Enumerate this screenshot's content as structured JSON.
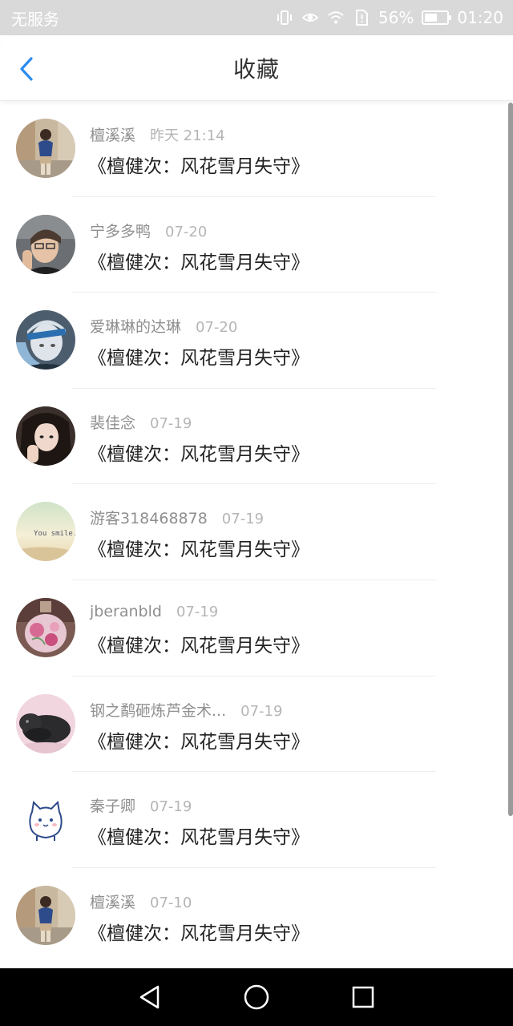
{
  "status_bar": {
    "carrier": "无服务",
    "battery": "56%",
    "battery_level": 0.56,
    "time": "01:20",
    "icons": [
      "vibrate-icon",
      "eye-icon",
      "wifi-icon",
      "sim-icon",
      "battery-icon"
    ]
  },
  "header": {
    "title": "收藏",
    "back_icon": "chevron-left-icon",
    "accent": "#2a8cf0"
  },
  "favorites": [
    {
      "user": "檀溪溪",
      "time": "昨天 21:14",
      "title": "《檀健次：风花雪月失守》",
      "avatar": "avatar-photo-walking"
    },
    {
      "user": "宁多多鸭",
      "time": "07-20",
      "title": "《檀健次：风花雪月失守》",
      "avatar": "avatar-photo-portrait"
    },
    {
      "user": "爱琳琳的达琳",
      "time": "07-20",
      "title": "《檀健次：风花雪月失守》",
      "avatar": "avatar-photo-headband"
    },
    {
      "user": "裴佳念",
      "time": "07-19",
      "title": "《檀健次：风花雪月失守》",
      "avatar": "avatar-photo-girl"
    },
    {
      "user": "游客318468878",
      "time": "07-19",
      "title": "《檀健次：风花雪月失守》",
      "avatar": "avatar-you-smile"
    },
    {
      "user": "jberanbld",
      "time": "07-19",
      "title": "《檀健次：风花雪月失守》",
      "avatar": "avatar-flower-bottle"
    },
    {
      "user": "钢之鹬砸炼芦金术...",
      "time": "07-19",
      "title": "《檀健次：风花雪月失守》",
      "avatar": "avatar-bunny"
    },
    {
      "user": "秦子卿",
      "time": "07-19",
      "title": "《檀健次：风花雪月失守》",
      "avatar": "avatar-cartoon-cat"
    },
    {
      "user": "檀溪溪",
      "time": "07-10",
      "title": "《檀健次：风花雪月失守》",
      "avatar": "avatar-photo-walking"
    }
  ],
  "avatars": {
    "avatar-you-smile": {
      "text": "You smile."
    }
  },
  "nav": {
    "back": "triangle-back-icon",
    "home": "circle-home-icon",
    "recents": "square-recents-icon"
  }
}
